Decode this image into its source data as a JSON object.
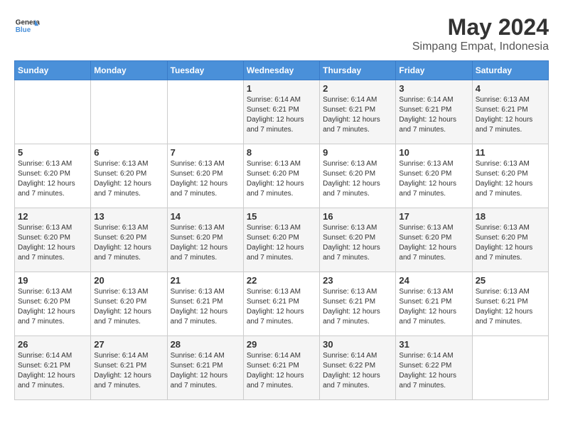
{
  "logo": {
    "text_general": "General",
    "text_blue": "Blue"
  },
  "title": "May 2024",
  "subtitle": "Simpang Empat, Indonesia",
  "days_header": [
    "Sunday",
    "Monday",
    "Tuesday",
    "Wednesday",
    "Thursday",
    "Friday",
    "Saturday"
  ],
  "weeks": [
    [
      {
        "day": "",
        "info": ""
      },
      {
        "day": "",
        "info": ""
      },
      {
        "day": "",
        "info": ""
      },
      {
        "day": "1",
        "info": "Sunrise: 6:14 AM\nSunset: 6:21 PM\nDaylight: 12 hours and 7 minutes."
      },
      {
        "day": "2",
        "info": "Sunrise: 6:14 AM\nSunset: 6:21 PM\nDaylight: 12 hours and 7 minutes."
      },
      {
        "day": "3",
        "info": "Sunrise: 6:14 AM\nSunset: 6:21 PM\nDaylight: 12 hours and 7 minutes."
      },
      {
        "day": "4",
        "info": "Sunrise: 6:13 AM\nSunset: 6:21 PM\nDaylight: 12 hours and 7 minutes."
      }
    ],
    [
      {
        "day": "5",
        "info": "Sunrise: 6:13 AM\nSunset: 6:20 PM\nDaylight: 12 hours and 7 minutes."
      },
      {
        "day": "6",
        "info": "Sunrise: 6:13 AM\nSunset: 6:20 PM\nDaylight: 12 hours and 7 minutes."
      },
      {
        "day": "7",
        "info": "Sunrise: 6:13 AM\nSunset: 6:20 PM\nDaylight: 12 hours and 7 minutes."
      },
      {
        "day": "8",
        "info": "Sunrise: 6:13 AM\nSunset: 6:20 PM\nDaylight: 12 hours and 7 minutes."
      },
      {
        "day": "9",
        "info": "Sunrise: 6:13 AM\nSunset: 6:20 PM\nDaylight: 12 hours and 7 minutes."
      },
      {
        "day": "10",
        "info": "Sunrise: 6:13 AM\nSunset: 6:20 PM\nDaylight: 12 hours and 7 minutes."
      },
      {
        "day": "11",
        "info": "Sunrise: 6:13 AM\nSunset: 6:20 PM\nDaylight: 12 hours and 7 minutes."
      }
    ],
    [
      {
        "day": "12",
        "info": "Sunrise: 6:13 AM\nSunset: 6:20 PM\nDaylight: 12 hours and 7 minutes."
      },
      {
        "day": "13",
        "info": "Sunrise: 6:13 AM\nSunset: 6:20 PM\nDaylight: 12 hours and 7 minutes."
      },
      {
        "day": "14",
        "info": "Sunrise: 6:13 AM\nSunset: 6:20 PM\nDaylight: 12 hours and 7 minutes."
      },
      {
        "day": "15",
        "info": "Sunrise: 6:13 AM\nSunset: 6:20 PM\nDaylight: 12 hours and 7 minutes."
      },
      {
        "day": "16",
        "info": "Sunrise: 6:13 AM\nSunset: 6:20 PM\nDaylight: 12 hours and 7 minutes."
      },
      {
        "day": "17",
        "info": "Sunrise: 6:13 AM\nSunset: 6:20 PM\nDaylight: 12 hours and 7 minutes."
      },
      {
        "day": "18",
        "info": "Sunrise: 6:13 AM\nSunset: 6:20 PM\nDaylight: 12 hours and 7 minutes."
      }
    ],
    [
      {
        "day": "19",
        "info": "Sunrise: 6:13 AM\nSunset: 6:20 PM\nDaylight: 12 hours and 7 minutes."
      },
      {
        "day": "20",
        "info": "Sunrise: 6:13 AM\nSunset: 6:20 PM\nDaylight: 12 hours and 7 minutes."
      },
      {
        "day": "21",
        "info": "Sunrise: 6:13 AM\nSunset: 6:21 PM\nDaylight: 12 hours and 7 minutes."
      },
      {
        "day": "22",
        "info": "Sunrise: 6:13 AM\nSunset: 6:21 PM\nDaylight: 12 hours and 7 minutes."
      },
      {
        "day": "23",
        "info": "Sunrise: 6:13 AM\nSunset: 6:21 PM\nDaylight: 12 hours and 7 minutes."
      },
      {
        "day": "24",
        "info": "Sunrise: 6:13 AM\nSunset: 6:21 PM\nDaylight: 12 hours and 7 minutes."
      },
      {
        "day": "25",
        "info": "Sunrise: 6:13 AM\nSunset: 6:21 PM\nDaylight: 12 hours and 7 minutes."
      }
    ],
    [
      {
        "day": "26",
        "info": "Sunrise: 6:14 AM\nSunset: 6:21 PM\nDaylight: 12 hours and 7 minutes."
      },
      {
        "day": "27",
        "info": "Sunrise: 6:14 AM\nSunset: 6:21 PM\nDaylight: 12 hours and 7 minutes."
      },
      {
        "day": "28",
        "info": "Sunrise: 6:14 AM\nSunset: 6:21 PM\nDaylight: 12 hours and 7 minutes."
      },
      {
        "day": "29",
        "info": "Sunrise: 6:14 AM\nSunset: 6:21 PM\nDaylight: 12 hours and 7 minutes."
      },
      {
        "day": "30",
        "info": "Sunrise: 6:14 AM\nSunset: 6:22 PM\nDaylight: 12 hours and 7 minutes."
      },
      {
        "day": "31",
        "info": "Sunrise: 6:14 AM\nSunset: 6:22 PM\nDaylight: 12 hours and 7 minutes."
      },
      {
        "day": "",
        "info": ""
      }
    ]
  ]
}
